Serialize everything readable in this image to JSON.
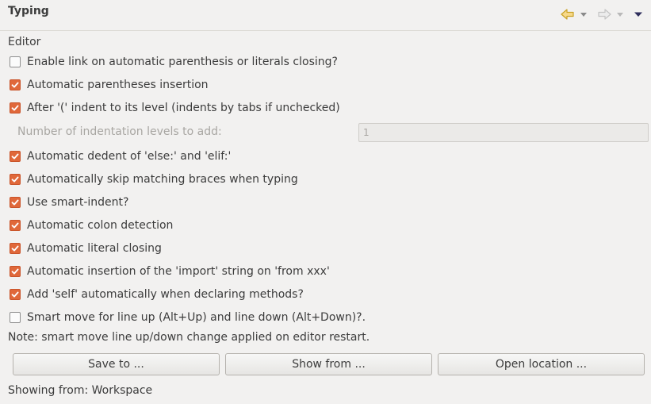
{
  "header": {
    "title": "Typing",
    "back_icon": "back-arrow-icon",
    "forward_icon": "forward-arrow-icon",
    "menu_icon": "view-menu-icon"
  },
  "colors": {
    "checkbox_checked": "#e0683a",
    "background": "#f2f1f0"
  },
  "editor": {
    "section_label": "Editor",
    "options": [
      {
        "label": "Enable link on automatic parenthesis or literals closing?",
        "checked": false
      },
      {
        "label": "Automatic parentheses insertion",
        "checked": true
      },
      {
        "label": "After '(' indent to its level (indents by tabs if unchecked)",
        "checked": true
      },
      {
        "label": "Automatic dedent of 'else:' and 'elif:'",
        "checked": true
      },
      {
        "label": "Automatically skip matching braces when typing",
        "checked": true
      },
      {
        "label": "Use smart-indent?",
        "checked": true
      },
      {
        "label": "Automatic colon detection",
        "checked": true
      },
      {
        "label": "Automatic literal closing",
        "checked": true
      },
      {
        "label": "Automatic insertion of the 'import' string on 'from xxx'",
        "checked": true
      },
      {
        "label": "Add 'self' automatically when declaring methods?",
        "checked": true
      },
      {
        "label": "Smart move for line up  (Alt+Up) and line down (Alt+Down)?.",
        "checked": false
      }
    ],
    "indentation": {
      "label": "Number of indentation levels to add:",
      "value": "1",
      "disabled": true
    },
    "note": "Note: smart move line up/down change applied on editor restart."
  },
  "buttons": {
    "save": "Save to ...",
    "show": "Show from ...",
    "open": "Open location ..."
  },
  "status": "Showing from: Workspace"
}
